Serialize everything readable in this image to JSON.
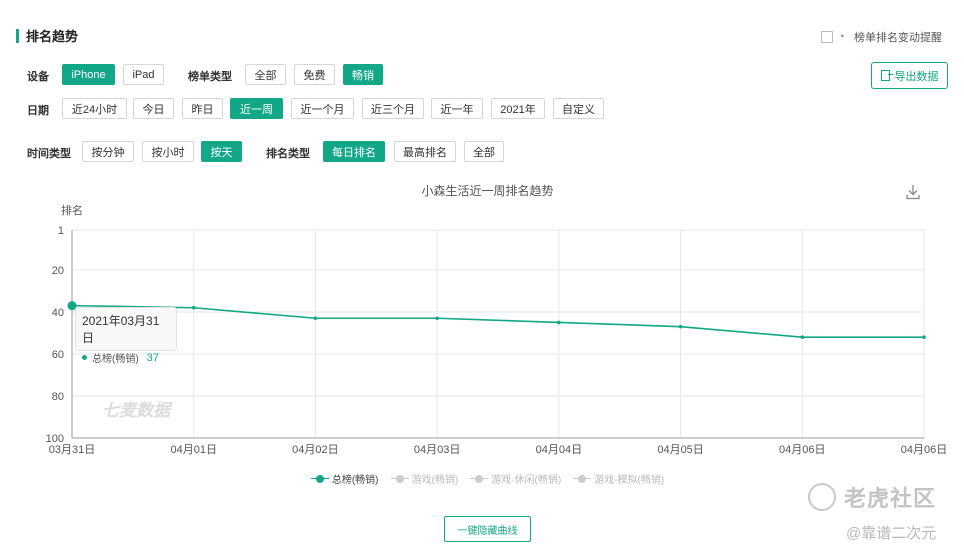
{
  "section": {
    "title": "排名趋势"
  },
  "alert": {
    "checkbox_checked": false,
    "label": "榜单排名变动提醒"
  },
  "export": {
    "label": "导出数据"
  },
  "filters": {
    "device": {
      "label": "设备",
      "options": [
        "iPhone",
        "iPad"
      ],
      "selected": "iPhone"
    },
    "list_type": {
      "label": "榜单类型",
      "options": [
        "全部",
        "免费",
        "畅销"
      ],
      "selected": "畅销"
    },
    "date": {
      "label": "日期",
      "options": [
        "近24小时",
        "今日",
        "昨日",
        "近一周",
        "近一个月",
        "近三个月",
        "近一年",
        "2021年",
        "自定义"
      ],
      "selected": "近一周"
    },
    "time_type": {
      "label": "时间类型",
      "options": [
        "按分钟",
        "按小时",
        "按天"
      ],
      "selected": "按天"
    },
    "rank_type": {
      "label": "排名类型",
      "options": [
        "每日排名",
        "最高排名",
        "全部"
      ],
      "selected": "每日排名"
    }
  },
  "chart_data": {
    "type": "line",
    "title": "小森生活近一周排名趋势",
    "ylabel": "排名",
    "y_inverted": true,
    "ylim": [
      1,
      100
    ],
    "yticks": [
      1,
      20,
      40,
      60,
      80,
      100
    ],
    "categories": [
      "03月31日",
      "04月01日",
      "04月02日",
      "04月03日",
      "04月04日",
      "04月05日",
      "04月06日",
      "04月06日"
    ],
    "series": [
      {
        "name": "总榜(畅销)",
        "visible": true,
        "color": "#12a787",
        "values": [
          37,
          38,
          43,
          43,
          45,
          47,
          52,
          52
        ]
      },
      {
        "name": "游戏(畅销)",
        "visible": false,
        "values": []
      },
      {
        "name": "游戏-休闲(畅销)",
        "visible": false,
        "values": []
      },
      {
        "name": "游戏-模拟(畅销)",
        "visible": false,
        "values": []
      }
    ],
    "grid": true,
    "legend_position": "bottom"
  },
  "tooltip": {
    "date": "2021年03月31日",
    "series": "总榜(畅销)",
    "value": "37"
  },
  "chart_watermark": "七麦数据",
  "hide_all_button": "一键隐藏曲线",
  "site_watermark": {
    "name": "老虎社区",
    "author": "@靠谱二次元"
  },
  "colors": {
    "accent": "#12a787"
  }
}
